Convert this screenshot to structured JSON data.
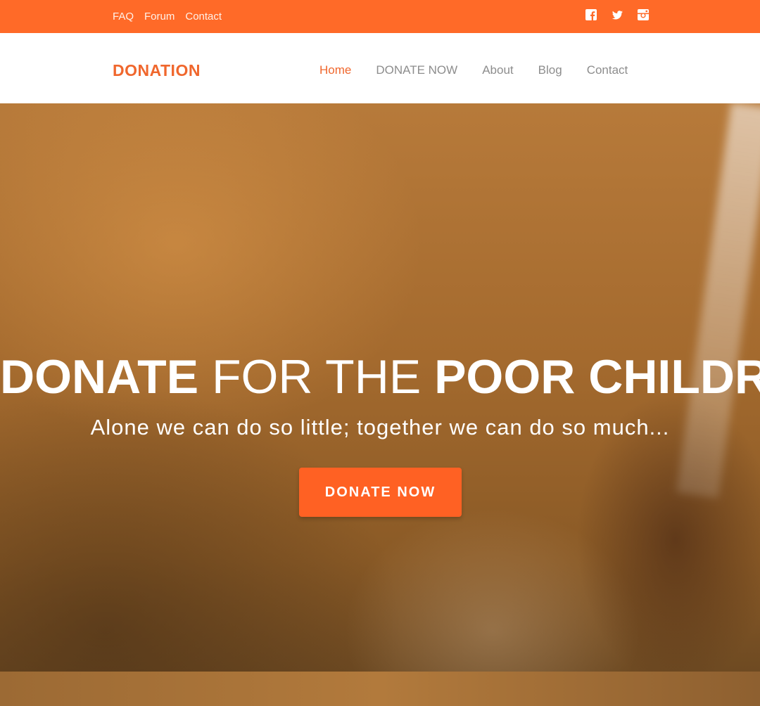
{
  "topbar": {
    "links": [
      "FAQ",
      "Forum",
      "Contact"
    ],
    "social_icons": [
      "facebook-icon",
      "twitter-icon",
      "instagram-icon"
    ],
    "color": "#ff6a28"
  },
  "header": {
    "logo": "DONATION",
    "nav": [
      "Home",
      "DONATE NOW",
      "About",
      "Blog",
      "Contact"
    ],
    "active": "Home",
    "accent": "#f0672d"
  },
  "hero": {
    "title_part1": "DONATE",
    "title_part2": "FOR THE",
    "title_part3": "POOR CHILDREN",
    "subtitle": "Alone we can do so little; together we can do so much...",
    "button": "DONATE NOW",
    "button_color": "#ff6123"
  }
}
